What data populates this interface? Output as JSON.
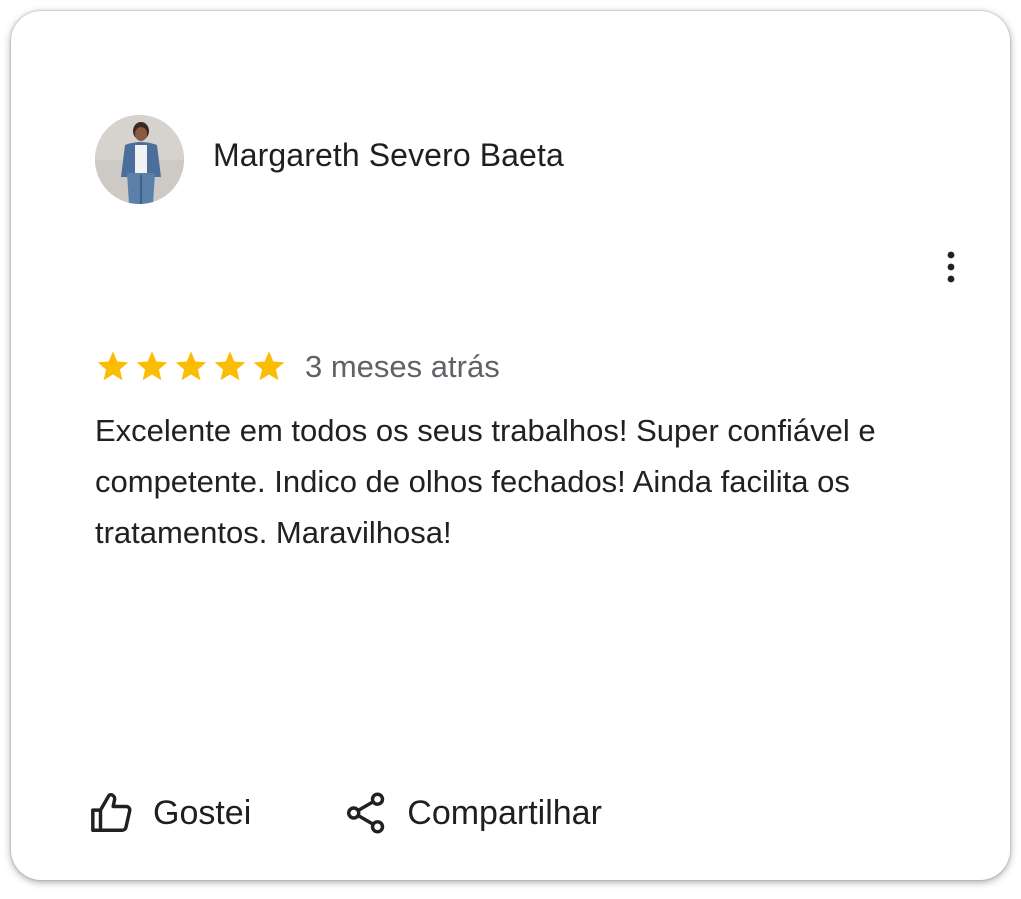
{
  "review": {
    "author_name": "Margareth Severo Baeta",
    "avatar_icon": "user-photo",
    "more_options_icon": "more-vert-icon",
    "rating": 5,
    "rating_max": 5,
    "star_color": "#fbbc04",
    "date": "3 meses atrás",
    "text": "Excelente em todos os seus trabalhos! Super confiável e competente. Indico de olhos fechados! Ainda facilita os tratamentos. Maravilhosa!"
  },
  "actions": {
    "like_label": "Gostei",
    "like_icon": "thumb-up-icon",
    "share_label": "Compartilhar",
    "share_icon": "share-icon"
  }
}
